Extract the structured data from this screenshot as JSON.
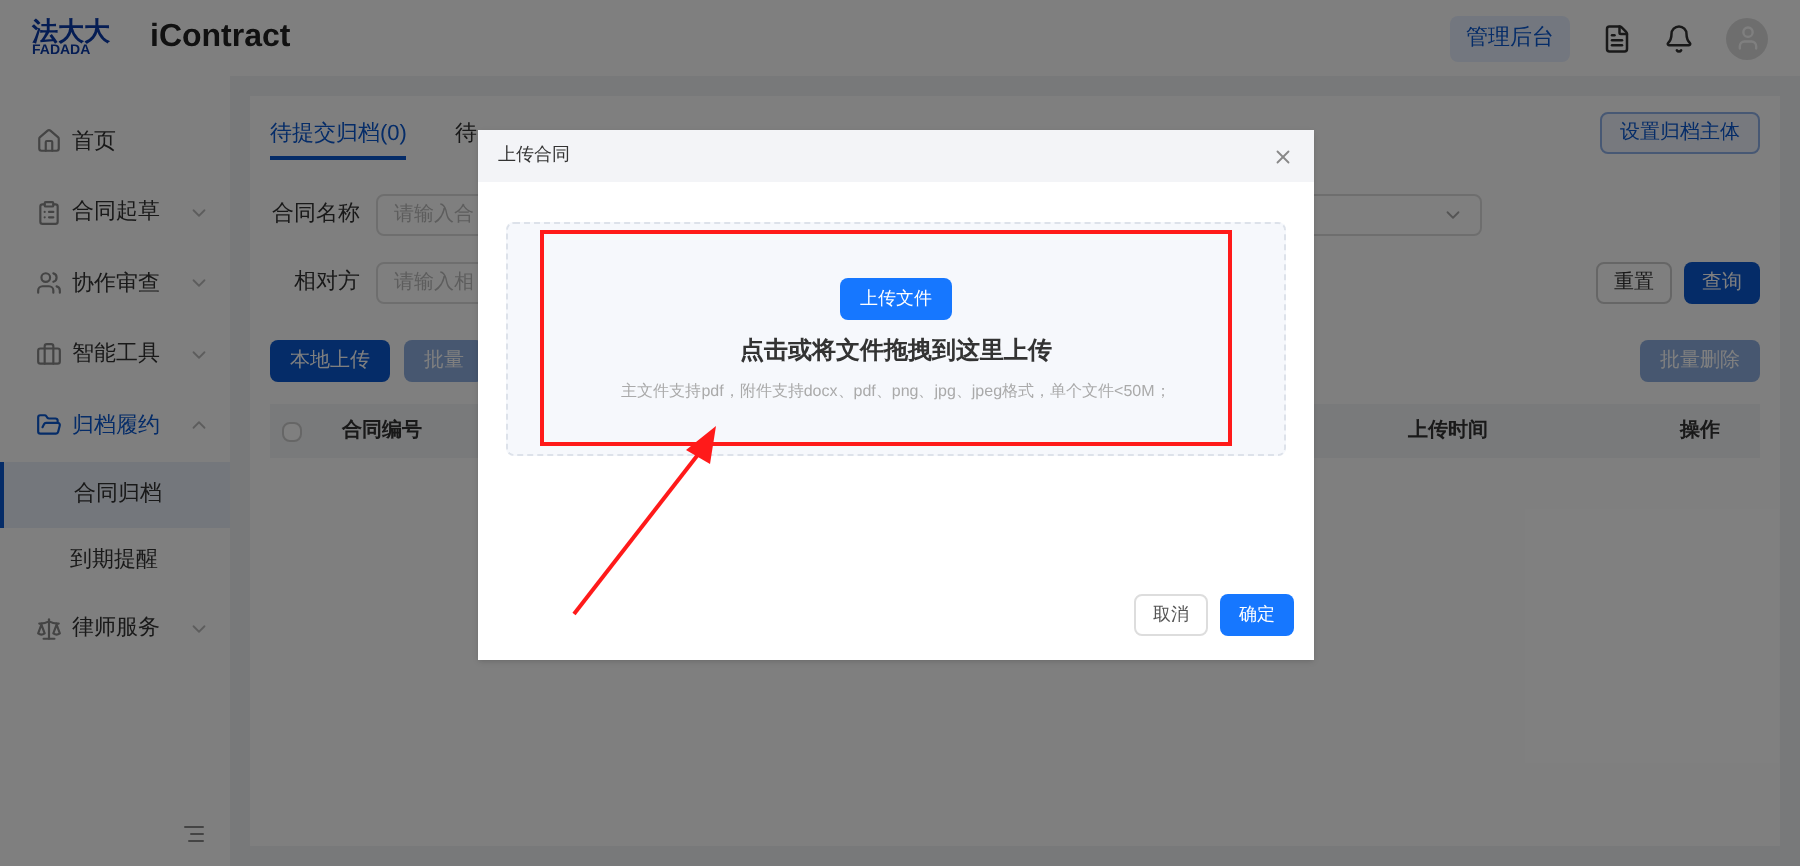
{
  "header": {
    "logo_cn": "法大大",
    "logo_en": "FADADA",
    "app_name": "iContract",
    "admin_button": "管理后台"
  },
  "sidebar": {
    "items": [
      {
        "label": "首页",
        "selected": false
      },
      {
        "label": "合同起草",
        "selected": false,
        "expanded": false
      },
      {
        "label": "协作审查",
        "selected": false,
        "expanded": false
      },
      {
        "label": "智能工具",
        "selected": false,
        "expanded": false
      },
      {
        "label": "归档履约",
        "selected": true,
        "expanded": true,
        "children": [
          {
            "label": "合同归档",
            "selected": true
          },
          {
            "label": "到期提醒",
            "selected": false
          }
        ]
      },
      {
        "label": "律师服务",
        "selected": false,
        "expanded": false
      }
    ]
  },
  "tabs": [
    {
      "label": "待提交归档(0)",
      "selected": true
    },
    {
      "label": "待",
      "selected": false
    }
  ],
  "settings_button": "设置归档主体",
  "filters": [
    {
      "label": "合同名称",
      "placeholder": "请输入合"
    },
    {
      "label": "相对方",
      "placeholder": "请输入相"
    }
  ],
  "reset_button": "重置",
  "query_button": "查询",
  "actions": [
    {
      "label": "本地上传",
      "disabled": false
    },
    {
      "label": "批量",
      "disabled": true
    }
  ],
  "delete_button": {
    "label": "批量删除",
    "disabled": true
  },
  "table": {
    "select_all_checked": false,
    "columns": [
      "合同编号",
      "上传时间",
      "操作"
    ]
  },
  "modal": {
    "title": "上传合同",
    "upload_button": "上传文件",
    "drop_text": "点击或将文件拖拽到这里上传",
    "hint": "主文件支持pdf，附件支持docx、pdf、png、jpg、jpeg格式，单个文件<50M；",
    "buttons": [
      {
        "label": "取消",
        "kind": "secondary"
      },
      {
        "label": "确定",
        "kind": "primary"
      }
    ]
  }
}
